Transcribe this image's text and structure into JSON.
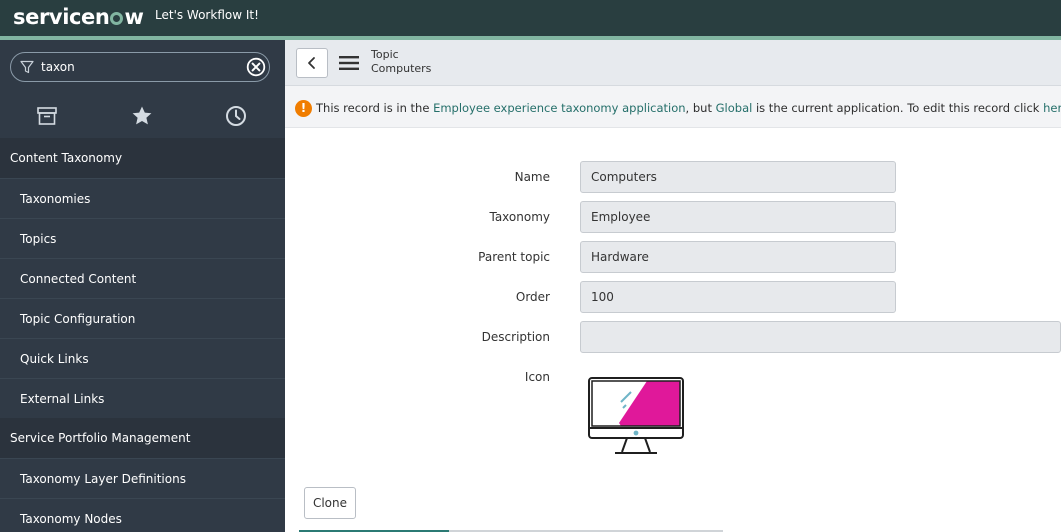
{
  "banner": {
    "logo_before": "servicen",
    "logo_after": "w",
    "tagline": "Let's Workflow It!"
  },
  "sidebar": {
    "filter_value": "taxon",
    "tab_icons": [
      "archive-icon",
      "star-icon",
      "clock-icon"
    ],
    "sections": [
      {
        "title": "Content Taxonomy",
        "items": [
          "Taxonomies",
          "Topics",
          "Connected Content",
          "Topic Configuration",
          "Quick Links",
          "External Links"
        ]
      },
      {
        "title": "Service Portfolio Management",
        "items": [
          "Taxonomy Layer Definitions",
          "Taxonomy Nodes"
        ]
      }
    ]
  },
  "header": {
    "record_type": "Topic",
    "record_name": "Computers"
  },
  "info": {
    "t1": "This record is in the ",
    "app": "Employee experience taxonomy application",
    "t2": ", but ",
    "scope": "Global",
    "t3": " is the current application. To edit this record click ",
    "here": "here",
    "t4": "."
  },
  "form": {
    "name_label": "Name",
    "name_value": "Computers",
    "taxonomy_label": "Taxonomy",
    "taxonomy_value": "Employee",
    "parent_label": "Parent topic",
    "parent_value": "Hardware",
    "order_label": "Order",
    "order_value": "100",
    "description_label": "Description",
    "description_value": "",
    "icon_label": "Icon"
  },
  "actions": {
    "clone_label": "Clone"
  },
  "colors": {
    "banner": "#293e40",
    "accent": "#81b5a1",
    "sidebar": "#303a46",
    "warning": "#f07d00",
    "icon_magenta": "#e0189a"
  }
}
